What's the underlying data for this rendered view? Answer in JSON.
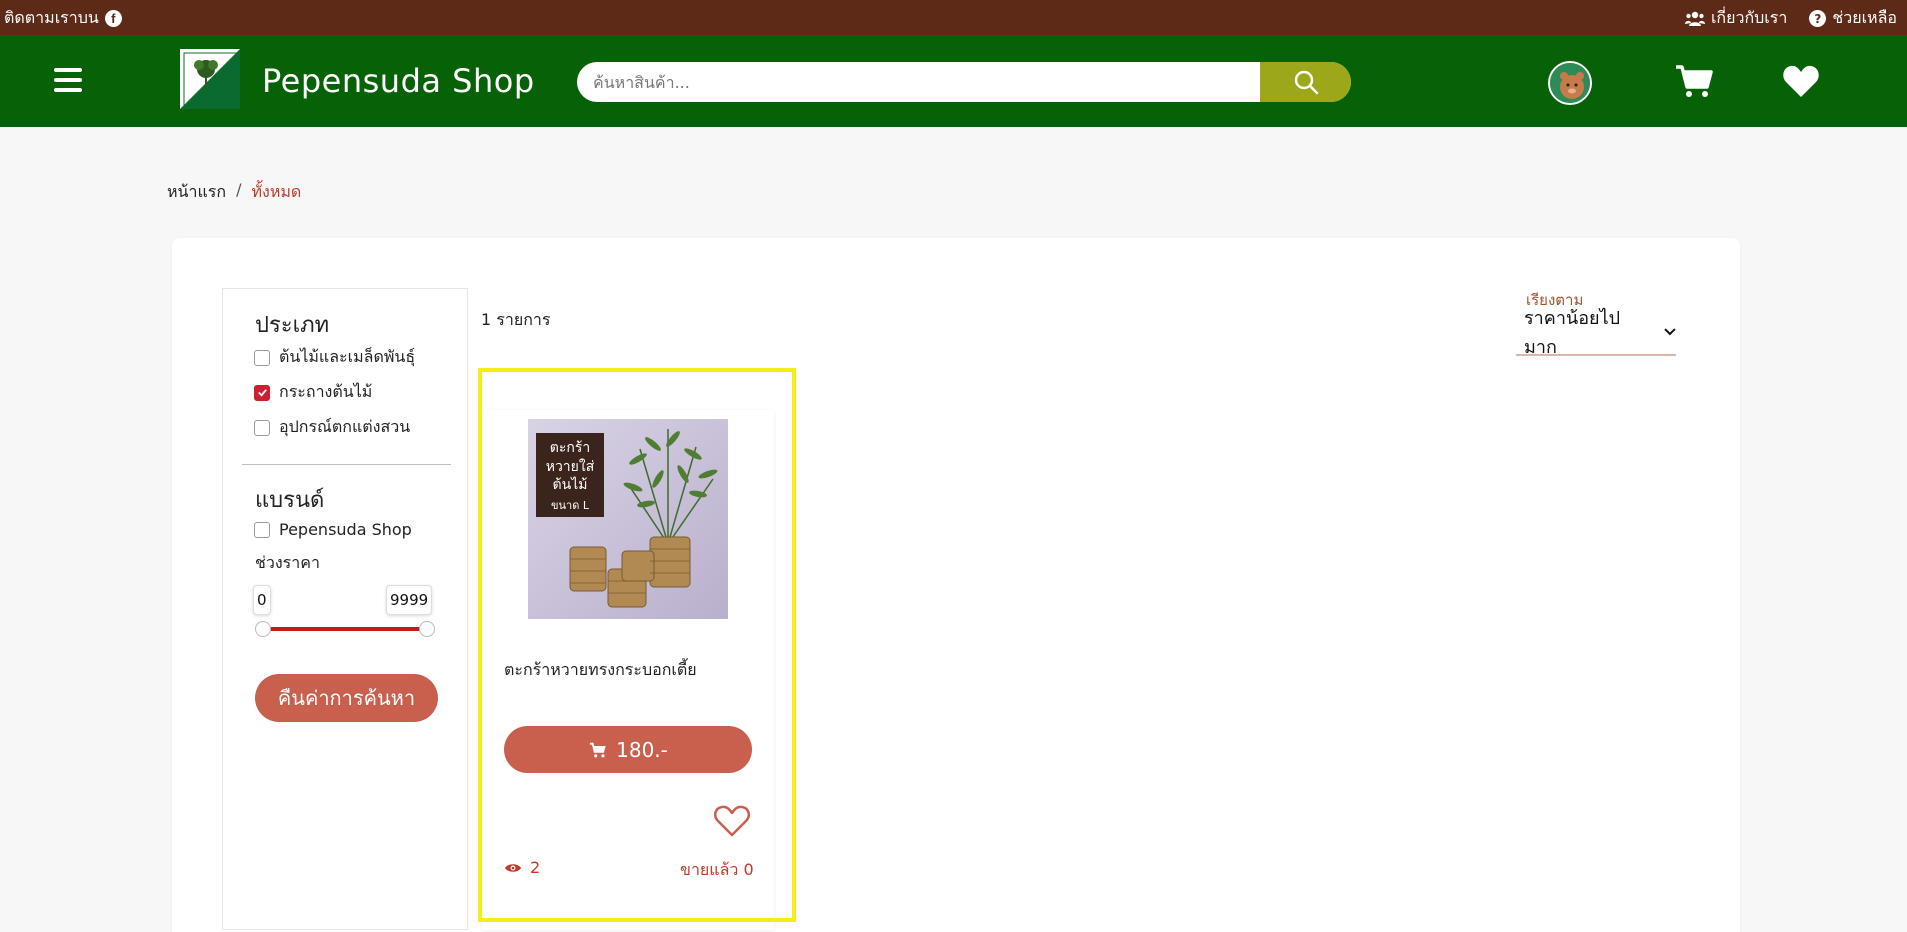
{
  "topbar": {
    "follow_text": "ติดตามเราบน",
    "about": "เกี่ยวกับเรา",
    "help": "ช่วยเหลือ"
  },
  "header": {
    "brand": "Pepensuda Shop",
    "search_placeholder": "ค้นหาสินค้า..."
  },
  "breadcrumb": {
    "home": "หน้าแรก",
    "separator": "/",
    "current": "ทั้งหมด"
  },
  "filters": {
    "category_title": "ประเภท",
    "categories": [
      {
        "label": "ต้นไม้และเมล็ดพันธุ์",
        "checked": false
      },
      {
        "label": "กระถางต้นไม้",
        "checked": true
      },
      {
        "label": "อุปกรณ์ตกแต่งสวน",
        "checked": false
      }
    ],
    "brand_title": "แบรนด์",
    "brands": [
      {
        "label": "Pepensuda Shop",
        "checked": false
      }
    ],
    "price_title": "ช่วงราคา",
    "price_min": "0",
    "price_max": "9999",
    "reset_label": "คืนค่าการค้นหา"
  },
  "results": {
    "count_text": "1 รายการ",
    "sort_label": "เรียงตาม",
    "sort_value": "ราคาน้อยไปมาก"
  },
  "products": [
    {
      "image_text": [
        "ตะกร้า",
        "หวายใส่",
        "ต้นไม้",
        "ขนาด L"
      ],
      "name": "ตะกร้าหวายทรงกระบอกเตี้ย",
      "price": "180.-",
      "views": "2",
      "sold": "ขายแล้ว 0"
    }
  ],
  "colors": {
    "topbar": "#5c2a17",
    "header": "#076107",
    "search_button": "#9ca71a",
    "accent_button": "#c8604d",
    "highlight": "#f5ee16",
    "link_red": "#c0392b"
  }
}
